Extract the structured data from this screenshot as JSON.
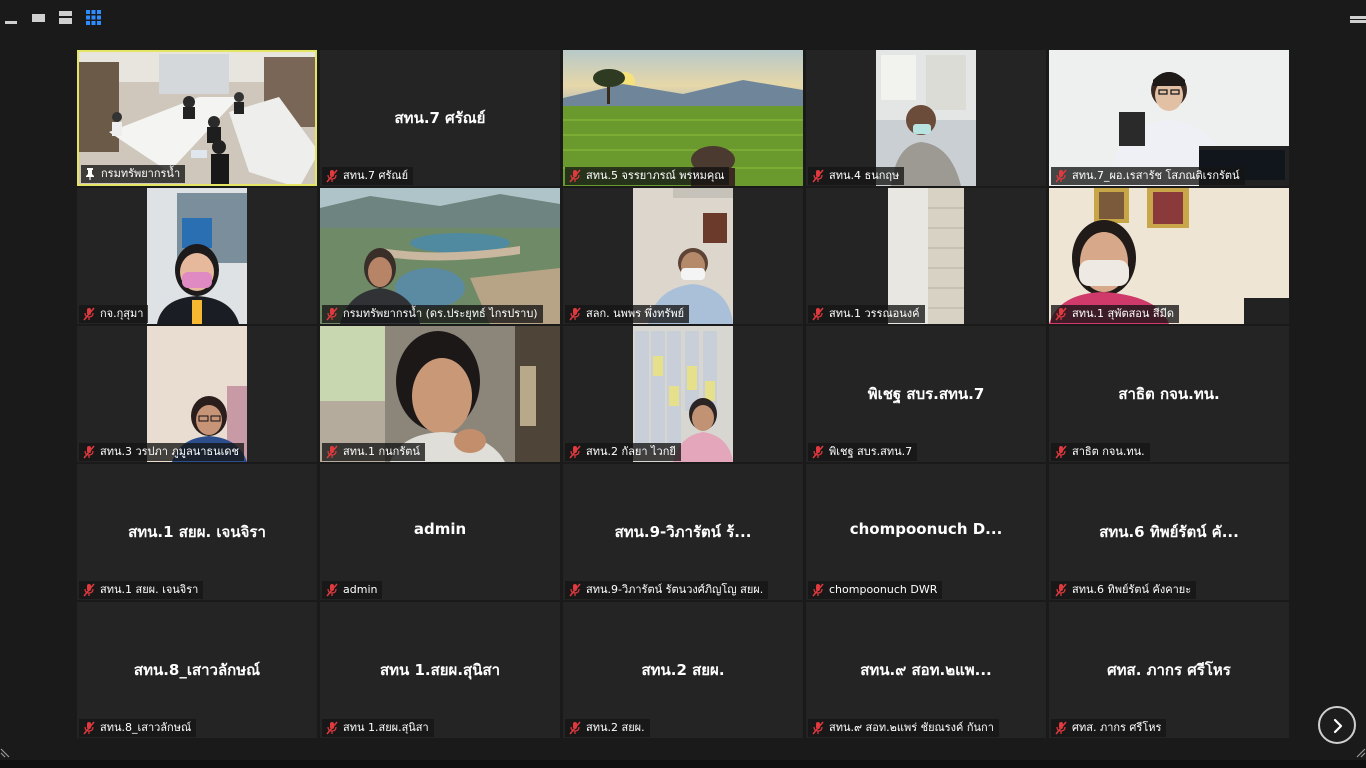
{
  "toolbar": {
    "minimize_icon": "minimize-icon",
    "speaker_view_icon": "speaker-view-icon",
    "strip_view_icon": "strip-view-icon",
    "gallery_view_icon": "gallery-view-icon",
    "fullscreen_icon": "exit-fullscreen-icon"
  },
  "colors": {
    "background": "#1a1a1a",
    "tile_background": "#242424",
    "active_speaker_border": "#e5e564",
    "muted_icon": "#e0393e",
    "gallery_view_accent": "#2d8cff"
  },
  "participants": [
    {
      "name": "กรมทรัพยากรน้ำ",
      "pinned": true,
      "active": true,
      "video": "meeting-room"
    },
    {
      "name": "สทน.7 ศรัณย์",
      "tile_label": "สทน.7 ศรัณย์",
      "muted": true
    },
    {
      "name": "สทน.5 จรรยาภรณ์ พรหมคุณ",
      "muted": true,
      "video": "rice-field-background"
    },
    {
      "name": "สทน.4 ธนกฤษ",
      "muted": true,
      "video": "masked-man-office"
    },
    {
      "name": "สทน.7_ผอ.เรสารัช โสภณติเรกรัตน์",
      "muted": true,
      "video": "man-at-desk"
    },
    {
      "name": "กจ.กุสุมา",
      "muted": true,
      "video": "woman-pink-mask"
    },
    {
      "name": "กรมทรัพยากรน้ำ (ดร.ประยุทธ์ ไกรปราบ)",
      "muted": true,
      "video": "reservoir-background"
    },
    {
      "name": "สลก. นพพร พึ่งทรัพย์",
      "muted": true,
      "video": "man-white-mask"
    },
    {
      "name": "สทน.1 วรรณอนงค์",
      "muted": true,
      "video": "empty-room-curtain"
    },
    {
      "name": "สทน.1 สุพัตสอน สีมีด",
      "muted": true,
      "video": "woman-mask-portraits"
    },
    {
      "name": "สทน.3 วรปภา ภูมูลนาธนเดช",
      "muted": true,
      "video": "woman-glasses"
    },
    {
      "name": "สทน.1 กนกรัตน์",
      "muted": true,
      "video": "woman-thinking"
    },
    {
      "name": "สทน.2 กัลยา ไวกยี",
      "muted": true,
      "video": "woman-bookshelf"
    },
    {
      "name": "พิเชฐ สบร.สทน.7",
      "tile_label": "พิเชฐ สบร.สทน.7",
      "muted": true
    },
    {
      "name": "สาธิต กจน.ทน.",
      "tile_label": "สาธิต กจน.ทน.",
      "muted": true
    },
    {
      "name": "สทน.1 สยผ. เจนจิรา",
      "tile_label": "สทน.1 สยผ. เจนจิรา",
      "muted": true
    },
    {
      "name": "admin",
      "tile_label": "admin",
      "muted": true
    },
    {
      "name": "สทน.9-วิภารัตน์ รัตนวงศ์ภิญโญ สยผ.",
      "tile_label": "สทน.9-วิภารัตน์ ร้...",
      "muted": true
    },
    {
      "name": "chompoonuch DWR",
      "tile_label": "chompoonuch  D...",
      "muted": true
    },
    {
      "name": "สทน.6 ทิพย์รัตน์ คังคายะ",
      "tile_label": "สทน.6 ทิพย์รัตน์ คั...",
      "muted": true
    },
    {
      "name": "สทน.8_เสาวลักษณ์",
      "tile_label": "สทน.8_เสาวลักษณ์",
      "muted": true
    },
    {
      "name": "สทน 1.สยผ.สุนิสา",
      "tile_label": "สทน 1.สยผ.สุนิสา",
      "muted": true
    },
    {
      "name": "สทน.2 สยผ.",
      "tile_label": "สทน.2 สยผ.",
      "muted": true
    },
    {
      "name": "สทน.๙ สอท.๒แพร่ ชัยณรงค์ กันกา",
      "tile_label": "สทน.๙ สอท.๒แพ...",
      "muted": true
    },
    {
      "name": "ศทส. ภากร ศรีโหร",
      "tile_label": "ศทส. ภากร ศรีโหร",
      "muted": true
    }
  ],
  "pagination": {
    "next_icon": "chevron-right-icon"
  }
}
